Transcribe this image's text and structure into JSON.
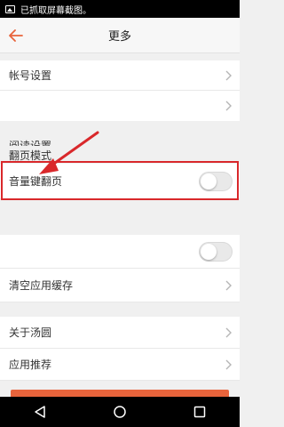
{
  "status_bar": {
    "notification": "已抓取屏幕截图。"
  },
  "header": {
    "title": "更多"
  },
  "settings": {
    "account_label": "帐号设置",
    "blank_row_label": "",
    "reading_section": "阅读设置",
    "page_mode_label": "翻页模式",
    "volume_key_label": "音量键翻页",
    "volume_key_enabled": false,
    "unlabeled_toggle_enabled": false,
    "clear_cache_label": "清空应用缓存",
    "about_label": "关于汤圆",
    "recommend_label": "应用推荐"
  },
  "colors": {
    "accent": "#e8643c",
    "highlight": "#d9282b",
    "background": "#f0f0f0"
  },
  "icons": [
    "back-arrow-icon",
    "chevron-right-icon",
    "back-nav-icon",
    "home-nav-icon",
    "recents-nav-icon",
    "screenshot-icon"
  ]
}
